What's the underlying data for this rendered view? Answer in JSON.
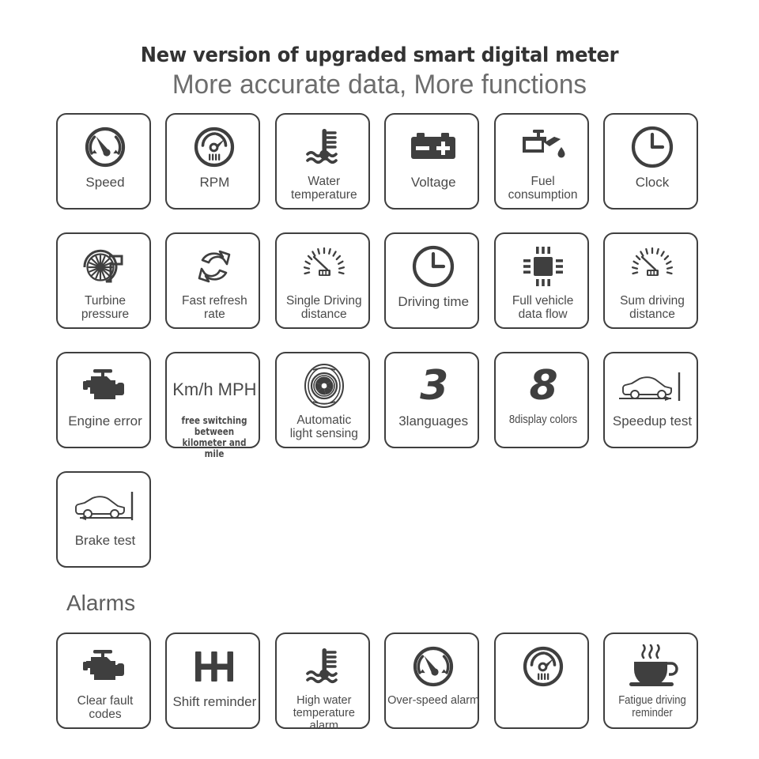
{
  "header": {
    "headline": "New version of upgraded smart digital meter",
    "subhead": "More accurate data,  More functions"
  },
  "sections": {
    "alarms_title": "Alarms"
  },
  "colors": {
    "icon": "#3f3f3f",
    "text": "#4a4a4a",
    "border": "#3f3f3f",
    "background": "#ffffff",
    "subhead": "#6d6d6d"
  },
  "features": [
    {
      "label": "Speed",
      "icon": "speedometer-icon"
    },
    {
      "label": "RPM",
      "icon": "rpm-gauge-icon"
    },
    {
      "label": "Water\ntemperature",
      "icon": "water-temperature-icon"
    },
    {
      "label": "Voltage",
      "icon": "battery-icon"
    },
    {
      "label": "Fuel\nconsumption",
      "icon": "oil-can-icon"
    },
    {
      "label": "Clock",
      "icon": "clock-icon"
    },
    {
      "label": "Turbine\npressure",
      "icon": "turbine-icon"
    },
    {
      "label": "Fast refresh\nrate",
      "icon": "refresh-arrows-icon"
    },
    {
      "label": "Single Driving\ndistance",
      "icon": "odometer-icon"
    },
    {
      "label": "Driving time",
      "icon": "clock-icon"
    },
    {
      "label": "Full vehicle\ndata flow",
      "icon": "chip-icon"
    },
    {
      "label": "Sum driving\ndistance",
      "icon": "odometer-icon"
    },
    {
      "label": "Engine error",
      "icon": "engine-icon"
    },
    {
      "label": "",
      "icon": "kmh-mph-text",
      "primary_text": "Km/h\nMPH",
      "secondary_text": "free switching between\nkilometer and mile"
    },
    {
      "label": "Automatic\nlight sensing",
      "icon": "aperture-icon"
    },
    {
      "label": "3languages",
      "icon": "digit-3",
      "digit": "3"
    },
    {
      "label": "8display colors",
      "icon": "digit-8",
      "digit": "8"
    },
    {
      "label": "Speedup test",
      "icon": "car-speedup-icon"
    },
    {
      "label": "Brake test",
      "icon": "car-brake-icon"
    }
  ],
  "alarms": [
    {
      "label": "Clear fault\ncodes",
      "icon": "engine-icon"
    },
    {
      "label": "Shift reminder",
      "icon": "gear-shift-icon"
    },
    {
      "label": "High water\ntemperature\nalarm",
      "icon": "water-temperature-icon"
    },
    {
      "label": "Over-speed alarm",
      "icon": "speedometer-icon"
    },
    {
      "label": "",
      "icon": "rpm-gauge-icon"
    },
    {
      "label": "Fatigue driving\nreminder",
      "icon": "coffee-cup-icon"
    }
  ]
}
